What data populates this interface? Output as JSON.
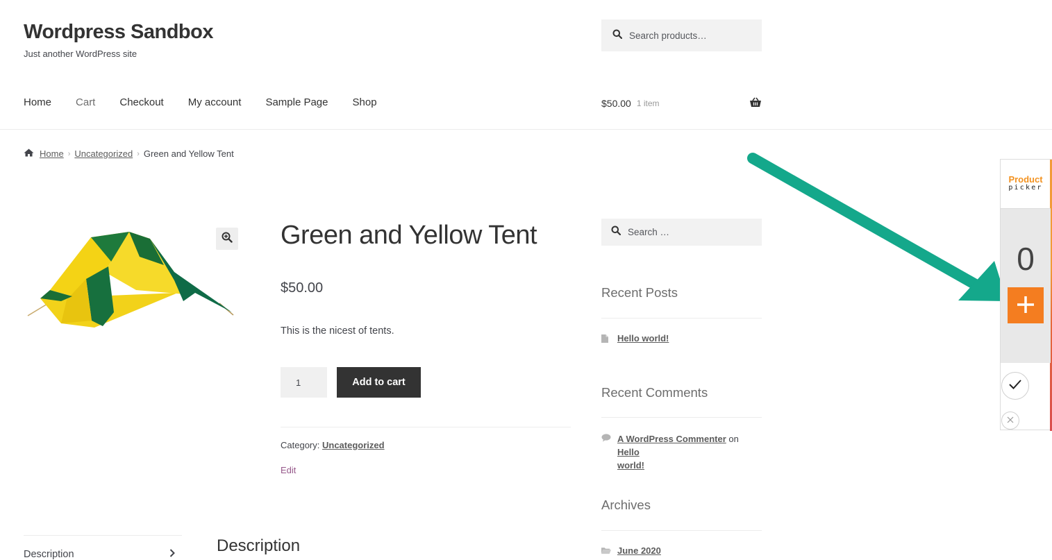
{
  "site": {
    "title": "Wordpress Sandbox",
    "tagline": "Just another WordPress site"
  },
  "header_search": {
    "placeholder": "Search products…"
  },
  "nav": {
    "items": [
      {
        "label": "Home"
      },
      {
        "label": "Cart"
      },
      {
        "label": "Checkout"
      },
      {
        "label": "My account"
      },
      {
        "label": "Sample Page"
      },
      {
        "label": "Shop"
      }
    ]
  },
  "cart": {
    "amount": "$50.00",
    "items": "1 item"
  },
  "breadcrumb": {
    "home": "Home",
    "category": "Uncategorized",
    "current": "Green and Yellow Tent"
  },
  "product": {
    "title": "Green and Yellow Tent",
    "price": "$50.00",
    "description": "This is the nicest of tents.",
    "quantity": "1",
    "add_to_cart": "Add to cart",
    "category_label": "Category:",
    "category": "Uncategorized",
    "edit": "Edit"
  },
  "tabs": {
    "description_tab": "Description",
    "description_heading": "Description"
  },
  "sidebar": {
    "search_placeholder": "Search …",
    "recent_posts_title": "Recent Posts",
    "recent_posts": [
      "Hello world!"
    ],
    "recent_comments_title": "Recent Comments",
    "comment": {
      "author": "A WordPress Commenter",
      "on": "on",
      "post_line1": "Hello",
      "post_line2": "world!"
    },
    "archives_title": "Archives",
    "archives": [
      "June 2020"
    ]
  },
  "product_picker": {
    "logo_line1": "Product",
    "logo_line2": "picker",
    "count": "0",
    "accent_color": "#f47d20"
  },
  "annotation": {
    "arrow_color": "#14a88b"
  },
  "icons": [
    "search-icon",
    "basket-icon",
    "home-icon",
    "zoom-icon",
    "document-icon",
    "comment-icon",
    "folder-icon",
    "chevron-right-icon",
    "plus-icon",
    "check-icon",
    "close-icon"
  ]
}
